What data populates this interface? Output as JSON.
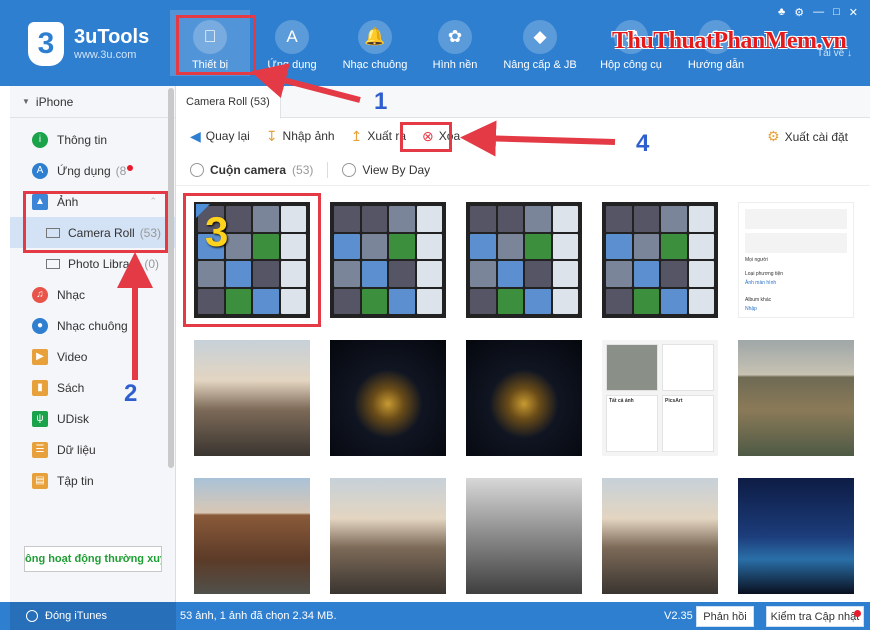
{
  "app": {
    "name": "3uTools",
    "site": "www.3u.com",
    "watermark": "ThuThuatPhanMem.vn"
  },
  "header": {
    "nav": [
      {
        "label": "Thiết bị",
        "icon": "apple-icon"
      },
      {
        "label": "Ứng dụng",
        "icon": "app-store-icon"
      },
      {
        "label": "Nhạc chuông",
        "icon": "bell-icon"
      },
      {
        "label": "Hình nền",
        "icon": "flower-icon"
      },
      {
        "label": "Nâng cấp & JB",
        "icon": "dropbox-icon"
      },
      {
        "label": "Hộp công cụ",
        "icon": "toolbox-icon"
      },
      {
        "label": "Hướng dẫn",
        "icon": "guide-icon"
      }
    ],
    "download_label": "Tải về"
  },
  "sidebar": {
    "device": "iPhone",
    "items": [
      {
        "label": "Thông tin",
        "icon": "info-icon",
        "color": "#1aa34a"
      },
      {
        "label": "Ứng dụng",
        "count": "(8",
        "icon": "app-store-icon",
        "color": "#2f7fd0"
      },
      {
        "label": "Ảnh",
        "icon": "photo-icon",
        "color": "#3b86d6"
      },
      {
        "label": "Camera Roll",
        "count": "(53)"
      },
      {
        "label": "Photo Library",
        "count": "(0)"
      },
      {
        "label": "Nhạc",
        "icon": "music-icon",
        "color": "#e8534a"
      },
      {
        "label": "Nhạc chuông",
        "icon": "bell-icon",
        "color": "#2f7fd0"
      },
      {
        "label": "Video",
        "icon": "video-icon",
        "color": "#e8a13a"
      },
      {
        "label": "Sách",
        "icon": "book-icon",
        "color": "#e8a13a"
      },
      {
        "label": "UDisk",
        "icon": "udisk-icon",
        "color": "#1aa34a"
      },
      {
        "label": "Dữ liệu",
        "icon": "data-icon",
        "color": "#e8a13a"
      },
      {
        "label": "Tập tin",
        "icon": "file-icon",
        "color": "#e8a13a"
      }
    ],
    "banner": "ông hoạt động thường xuyê"
  },
  "content": {
    "tab": "Camera Roll (53)",
    "toolbar": {
      "back": "Quay lại",
      "import": "Nhập ảnh",
      "export": "Xuất ra",
      "delete": "Xóa",
      "export_settings": "Xuất cài đặt"
    },
    "filters": {
      "camera_roll": "Cuộn camera",
      "count": "(53)",
      "view_by_day": "View By Day"
    },
    "settings_thumb": {
      "title": "Mọi người",
      "section1": "Loại phương tiện",
      "row1": "Ảnh màn hình",
      "section2": "Album khác",
      "row2": "Nhập"
    },
    "album_thumb": {
      "left": "Tất cả ảnh",
      "right": "PicsArt"
    }
  },
  "statusbar": {
    "itunes": "Đóng iTunes",
    "info": "53 ảnh, 1 ảnh đã chọn 2.34 MB.",
    "version": "V2.35",
    "feedback": "Phản hồi",
    "update": "Kiểm tra Cập nhật"
  },
  "annotations": {
    "n1": "1",
    "n2": "2",
    "n3": "3",
    "n4": "4"
  },
  "colors": {
    "brand": "#2f7fd0",
    "annotation": "#e43a45",
    "annotation_number": "#2f5fcf"
  }
}
